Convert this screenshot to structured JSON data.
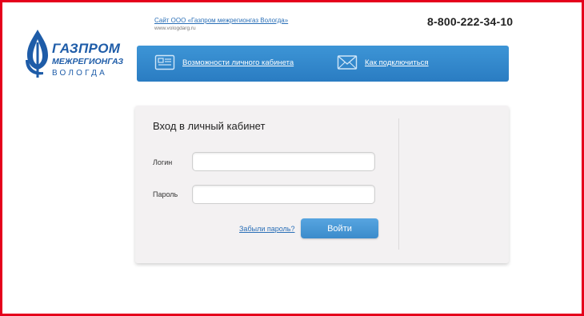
{
  "header": {
    "logo": {
      "line1": "ГАЗПРОМ",
      "line2": "МЕЖРЕГИОНГАЗ",
      "line3": "ВОЛОГДА"
    },
    "site_link": "Сайт ООО «Газпром межрегионгаз Вологда»",
    "site_url": "www.vologdarg.ru",
    "phone": "8-800-222-34-10"
  },
  "nav": {
    "items": [
      {
        "label": "Возможности личного кабинета",
        "icon": "document-icon"
      },
      {
        "label": "Как подключиться",
        "icon": "envelope-icon"
      }
    ]
  },
  "login": {
    "title": "Вход в личный кабинет",
    "login_label": "Логин",
    "login_value": "",
    "password_label": "Пароль",
    "password_value": "",
    "forgot_label": "Забыли пароль?",
    "submit_label": "Войти"
  },
  "colors": {
    "brand_blue": "#1e5ca8",
    "bar_blue": "#2a7cc2",
    "border_red": "#e5001c"
  }
}
